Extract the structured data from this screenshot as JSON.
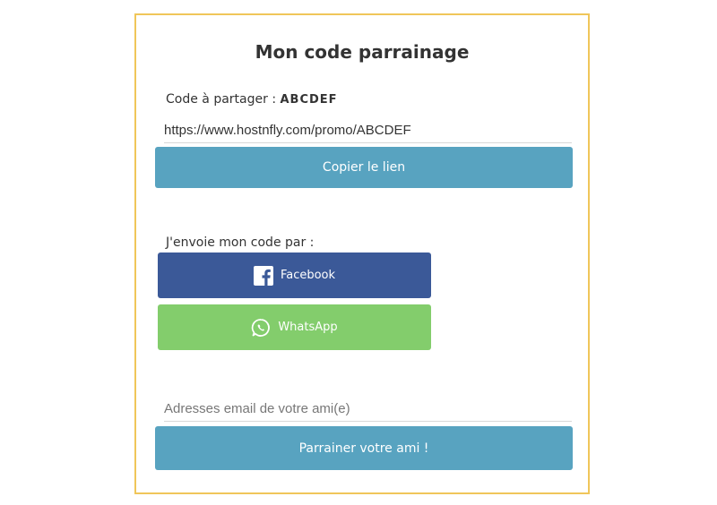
{
  "card": {
    "title": "Mon code parrainage",
    "code_label": "Code à partager : ",
    "code_value": "ABCDEF",
    "share_link": "https://www.hostnfly.com/promo/ABCDEF",
    "copy_button": "Copier le lien",
    "send_label": "J'envoie mon code par :",
    "facebook_button": "Facebook",
    "whatsapp_button": "WhatsApp",
    "email_placeholder": "Adresses email de votre ami(e)",
    "refer_button": "Parrainer votre ami !"
  },
  "icons": {
    "facebook": "facebook-icon",
    "whatsapp": "whatsapp-icon"
  },
  "colors": {
    "card_border": "#f0c65a",
    "primary_button": "#58a3c0",
    "facebook": "#3b5998",
    "whatsapp": "#83cd6c"
  }
}
